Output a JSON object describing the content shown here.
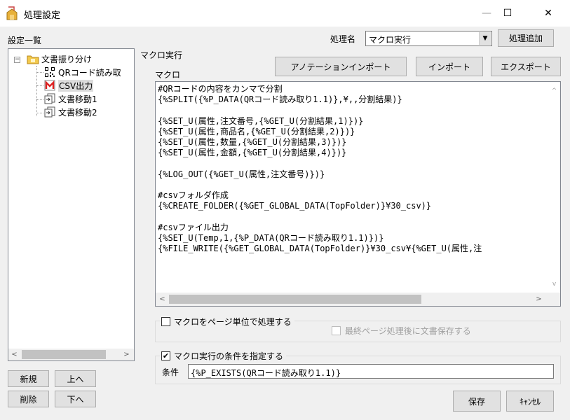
{
  "window": {
    "title": "処理設定",
    "minimize_glyph": "—",
    "maximize_glyph": "☐",
    "close_glyph": "✕"
  },
  "left": {
    "list_label": "設定一覧",
    "tree": [
      {
        "label": "文書振り分け",
        "icon": "folder-icon"
      },
      {
        "label": "QRコード読み取",
        "icon": "qr-code-icon"
      },
      {
        "label": "CSV出力",
        "icon": "csv-output-icon",
        "selected": true
      },
      {
        "label": "文書移動1",
        "icon": "document-move-icon"
      },
      {
        "label": "文書移動2",
        "icon": "document-move-icon"
      }
    ],
    "expander": "−",
    "buttons": {
      "new": "新規",
      "up": "上へ",
      "delete": "削除",
      "down": "下へ"
    }
  },
  "header": {
    "process_name_label": "処理名",
    "process_name_value": "マクロ実行",
    "add_process_button": "処理追加"
  },
  "main": {
    "section_label": "マクロ実行",
    "macro_label": "マクロ",
    "annotation_import_button": "アノテーションインポート",
    "import_button": "インポート",
    "export_button": "エクスポート",
    "macro_text": "#QRコードの内容をカンマで分割\n{%SPLIT({%P_DATA(QRコード読み取り1.1)},¥,,分割結果)}\n\n{%SET_U(属性,注文番号,{%GET_U(分割結果,1)})}\n{%SET_U(属性,商品名,{%GET_U(分割結果,2)})}\n{%SET_U(属性,数量,{%GET_U(分割結果,3)})}\n{%SET_U(属性,金額,{%GET_U(分割結果,4)})}\n\n{%LOG_OUT({%GET_U(属性,注文番号)})}\n\n#csvフォルダ作成\n{%CREATE_FOLDER({%GET_GLOBAL_DATA(TopFolder)}¥30_csv)}\n\n#csvファイル出力\n{%SET_U(Temp,1,{%P_DATA(QRコード読み取り1.1)})}\n{%FILE_WRITE({%GET_GLOBAL_DATA(TopFolder)}¥30_csv¥{%GET_U(属性,注"
  },
  "options": {
    "page_unit_label": "マクロをページ単位で処理する",
    "page_unit_checked": false,
    "save_after_last_page_label": "最終ページ処理後に文書保存する",
    "save_after_last_page_checked": false,
    "condition_enable_label": "マクロ実行の条件を指定する",
    "condition_enable_checked": true,
    "check_mark": "✔",
    "condition_label": "条件",
    "condition_value": "{%P_EXISTS(QRコード読み取り1.1)}"
  },
  "footer": {
    "save_button": "保存",
    "cancel_button": "ｷｬﾝｾﾙ"
  },
  "scroll_glyphs": {
    "left": "<",
    "right": ">",
    "up": "^",
    "down": "v",
    "dropdown": "▼"
  }
}
